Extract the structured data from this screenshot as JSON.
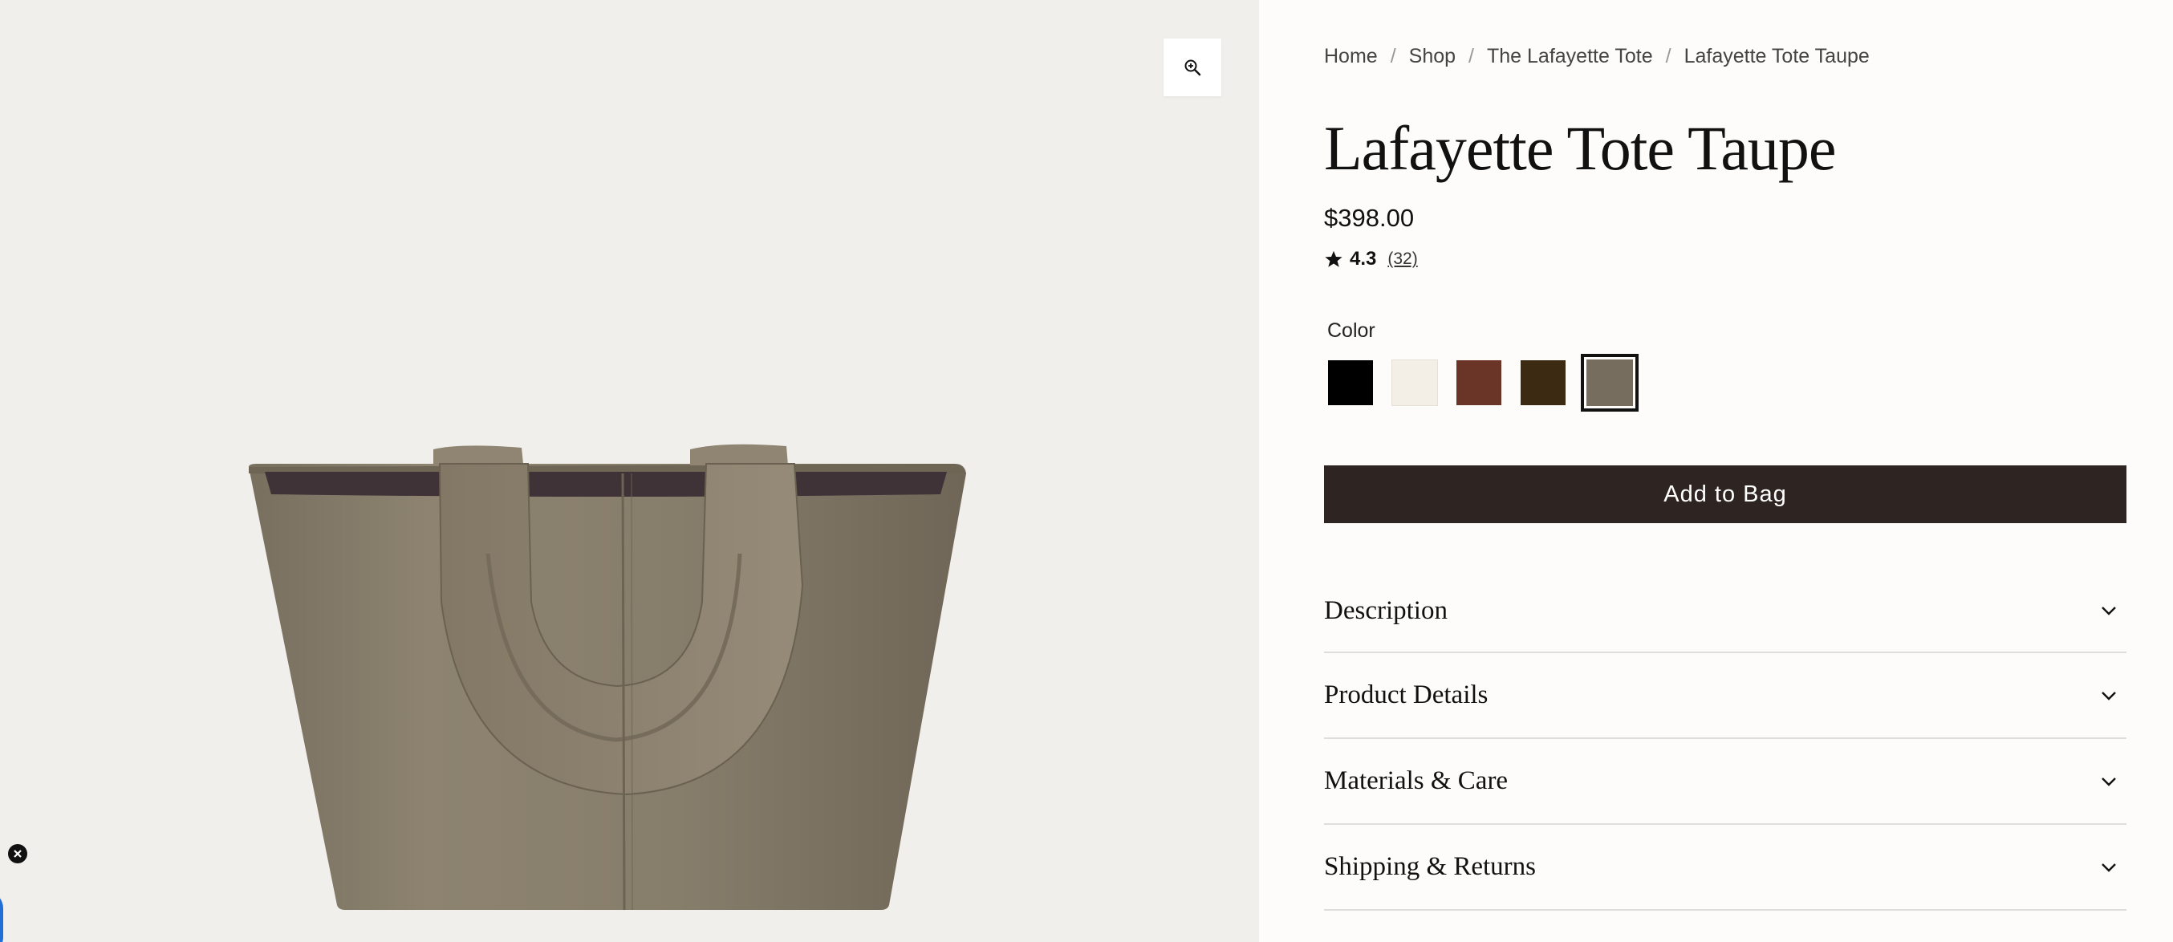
{
  "breadcrumb": [
    {
      "label": "Home"
    },
    {
      "label": "Shop"
    },
    {
      "label": "The Lafayette Tote"
    },
    {
      "label": "Lafayette Tote Taupe"
    }
  ],
  "breadcrumb_separator": "/",
  "product": {
    "title": "Lafayette Tote Taupe",
    "price": "$398.00",
    "rating": "4.3",
    "review_count": "(32)"
  },
  "color_picker": {
    "label": "Color",
    "swatches": [
      {
        "color": "#000000",
        "selected": false
      },
      {
        "color": "#f3eee6",
        "selected": false
      },
      {
        "color": "#6a3527",
        "selected": false
      },
      {
        "color": "#3c2a12",
        "selected": false
      },
      {
        "color": "#766d5e",
        "selected": true
      }
    ]
  },
  "add_to_bag_label": "Add to Bag",
  "accordion": [
    {
      "label": "Description"
    },
    {
      "label": "Product Details"
    },
    {
      "label": "Materials & Care"
    },
    {
      "label": "Shipping & Returns"
    }
  ],
  "icons": {
    "zoom": "zoom-in-icon",
    "rating": "star-icon",
    "accordion": "chevron-down-icon",
    "badge": "close-icon"
  },
  "colors": {
    "button_bg": "#2e2523",
    "gallery_bg": "#f0efeb",
    "product_taupe": "#8a7f6c"
  }
}
